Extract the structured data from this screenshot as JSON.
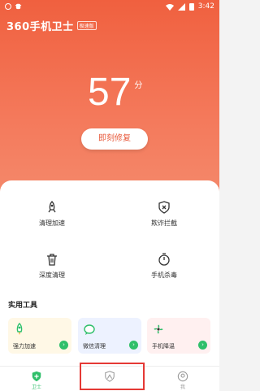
{
  "status_bar": {
    "time": "3:42"
  },
  "brand": {
    "name": "360手机卫士",
    "tag": "极速版"
  },
  "score": {
    "value": "57",
    "unit": "分"
  },
  "fix_button": {
    "label": "即刻修复"
  },
  "tools": [
    {
      "label": "清理加速",
      "icon": "rocket-icon"
    },
    {
      "label": "欺诈拦截",
      "icon": "shield-x-icon"
    },
    {
      "label": "深度清理",
      "icon": "trash-icon"
    },
    {
      "label": "手机杀毒",
      "icon": "scan-icon"
    }
  ],
  "section": {
    "title": "实用工具"
  },
  "utilities": [
    {
      "label": "强力加速",
      "icon": "rocket-green-icon",
      "bg": "#fff8e6"
    },
    {
      "label": "微信清理",
      "icon": "wechat-bubble-icon",
      "bg": "#edf2ff"
    },
    {
      "label": "手机降温",
      "icon": "fan-icon",
      "bg": "#fff0f0"
    }
  ],
  "bottom_nav": [
    {
      "label": "卫士",
      "icon": "guard-icon"
    },
    {
      "label": "",
      "icon": "person-icon"
    },
    {
      "label": "我",
      "icon": "avatar-icon"
    }
  ],
  "colors": {
    "hero": "#f0603f",
    "accent_green": "#2fbf6a",
    "highlight": "#e53935"
  }
}
